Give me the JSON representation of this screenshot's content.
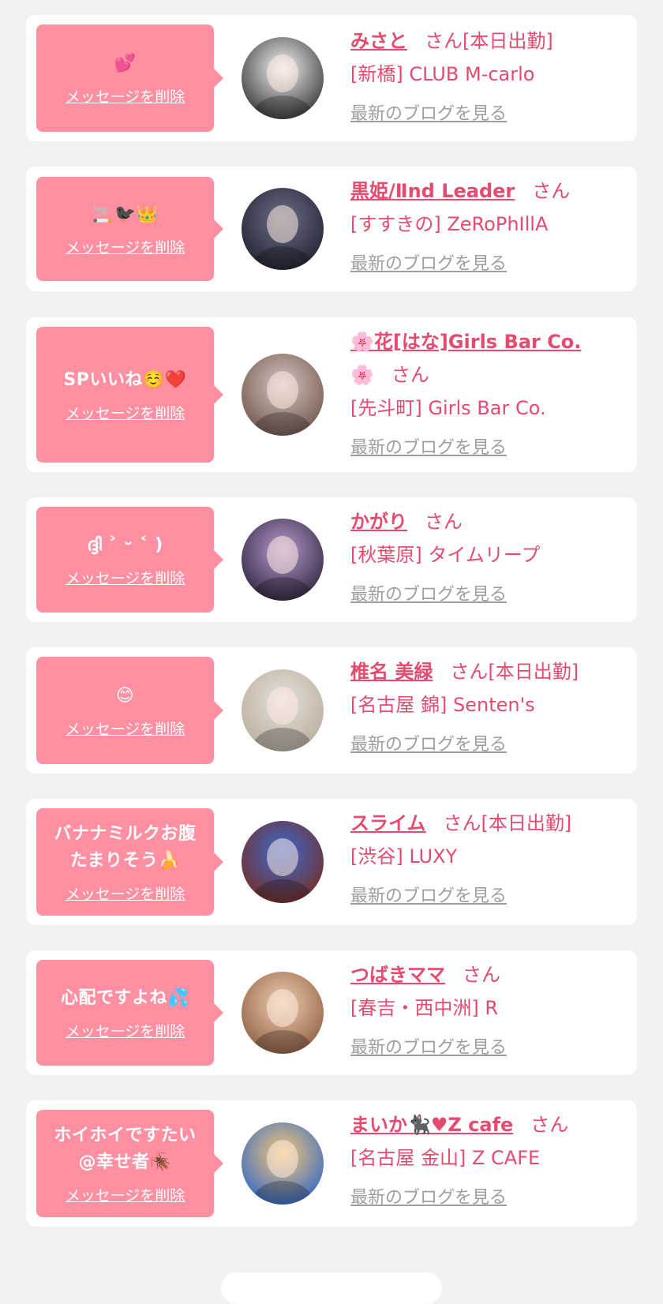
{
  "items": [
    {
      "message": "💕",
      "delete_label": "メッセージを削除",
      "name": "みさと",
      "san": "さん",
      "status": "[本日出勤]",
      "shop": "[新橋] CLUB M-carlo",
      "blog_label": "最新のブログを見る",
      "avatar_colors": [
        "#f4f4f4",
        "#2b2b2b"
      ]
    },
    {
      "message": "🚬🐦‍⬛👑",
      "delete_label": "メッセージを削除",
      "name": "黒姫/Ⅱnd Leader",
      "san": "さん",
      "status": "",
      "shop": "[すすきの] ZeRoPhIllA",
      "blog_label": "最新のブログを見る",
      "avatar_colors": [
        "#6b6f88",
        "#1e1e2c"
      ]
    },
    {
      "message": "SPいいね☺️❤️",
      "delete_label": "メッセージを削除",
      "name": "🌸花[はな]Girls Bar Co.",
      "name_second_line": "🌸",
      "san": "さん",
      "status": "",
      "shop": "[先斗町] Girls Bar Co.",
      "blog_label": "最新のブログを見る",
      "avatar_colors": [
        "#d7c6bf",
        "#6b5148"
      ]
    },
    {
      "message": "ദ്ദി ˃ ᵕ ˂ )",
      "delete_label": "メッセージを削除",
      "name": "かがり",
      "san": "さん",
      "status": "",
      "shop": "[秋葉原] タイムリープ",
      "blog_label": "最新のブログを見る",
      "avatar_colors": [
        "#b79ad0",
        "#2a2036"
      ]
    },
    {
      "message": "😊",
      "delete_label": "メッセージを削除",
      "name": "椎名 美緑",
      "san": "さん",
      "status": "[本日出勤]",
      "shop": "[名古屋 錦] Senten's",
      "blog_label": "最新のブログを見る",
      "avatar_colors": [
        "#e6e1d8",
        "#b7ab9a"
      ]
    },
    {
      "message": "バナナミルクお腹\nたまりそう🍌",
      "delete_label": "メッセージを削除",
      "name": "スライム",
      "san": "さん",
      "status": "[本日出勤]",
      "shop": "[渋谷] LUXY",
      "blog_label": "最新のブログを見る",
      "avatar_colors": [
        "#3a6ad0",
        "#7a2a1a"
      ]
    },
    {
      "message": "心配ですよね💦",
      "delete_label": "メッセージを削除",
      "name": "つばきママ",
      "san": "さん",
      "status": "",
      "shop": "[春吉・西中洲] R",
      "blog_label": "最新のブログを見る",
      "avatar_colors": [
        "#f0cdb0",
        "#8b5a3c"
      ]
    },
    {
      "message": "ホイホイですたい\n@幸せ者🪳",
      "delete_label": "メッセージを削除",
      "name": "まいか🐈‍⬛♥Z cafe",
      "san": "さん",
      "status": "",
      "shop": "[名古屋 金山] Z CAFE",
      "blog_label": "最新のブログを見る",
      "avatar_colors": [
        "#f6c87a",
        "#2a64c8"
      ]
    }
  ],
  "colors": {
    "accent": "#e44b6e",
    "bubble": "#ff8fa1",
    "link_gray": "#9e9e9e",
    "background": "#f2f2f2"
  }
}
